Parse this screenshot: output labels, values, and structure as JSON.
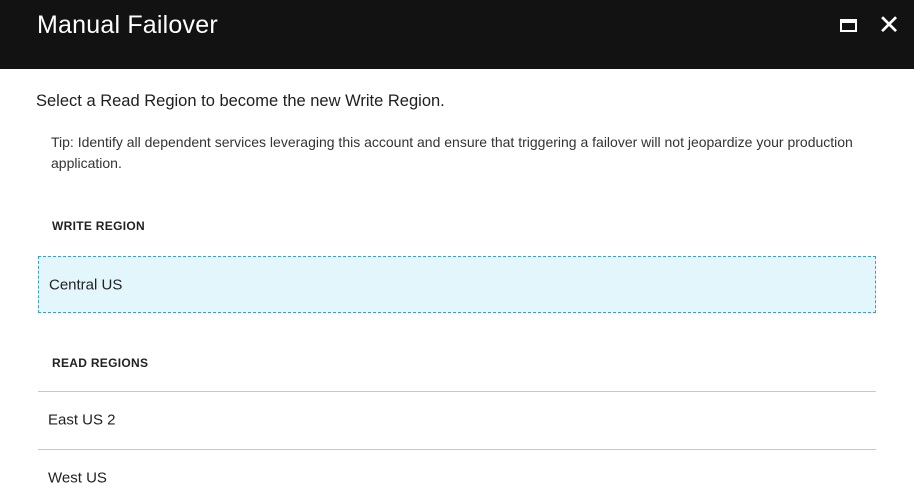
{
  "window": {
    "title": "Manual Failover",
    "maximize_icon": "maximize-icon",
    "close_icon": "close-icon",
    "close_glyph": "✕"
  },
  "content": {
    "instruction": "Select a Read Region to become the new Write Region.",
    "tip": "Tip: Identify all dependent services leveraging this account and ensure that triggering a failover will not jeopardize your production application."
  },
  "write_region": {
    "header": "WRITE REGION",
    "selected": "Central US"
  },
  "read_regions": {
    "header": "READ REGIONS",
    "items": [
      {
        "label": "East US 2"
      },
      {
        "label": "West US"
      }
    ]
  },
  "colors": {
    "titlebar": "#121212",
    "selected_row_bg": "#e3f6fb",
    "selected_row_border": "#3f9bd3"
  }
}
